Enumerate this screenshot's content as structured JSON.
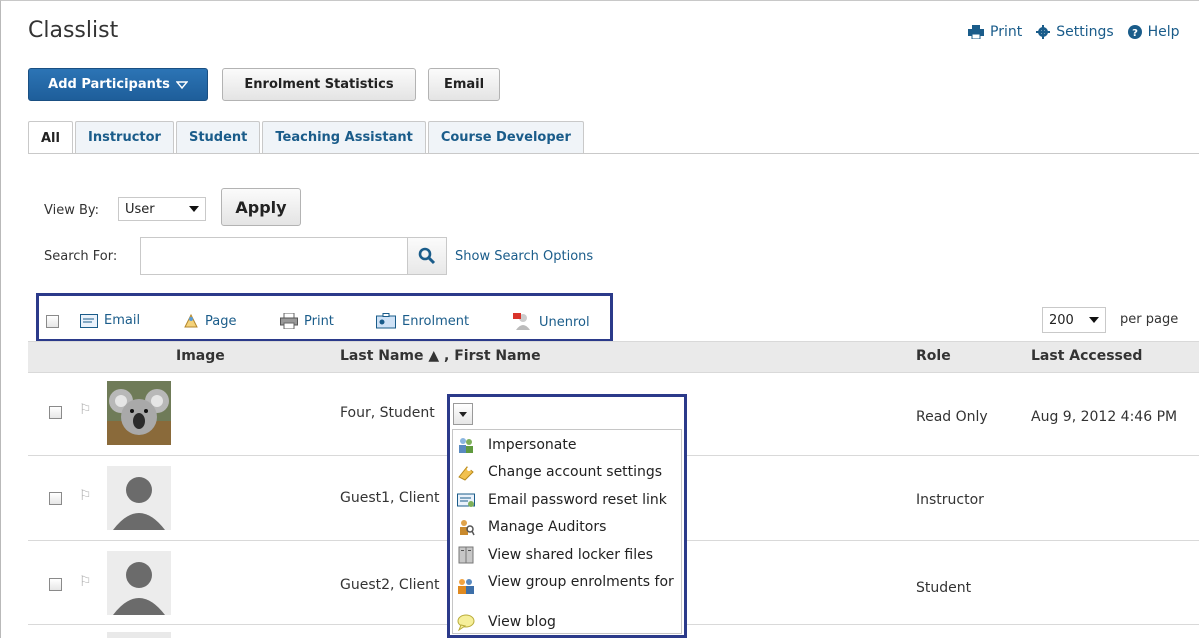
{
  "page": {
    "title": "Classlist"
  },
  "top_links": {
    "print": "Print",
    "settings": "Settings",
    "help": "Help"
  },
  "toolbar": {
    "add_participants": "Add Participants",
    "enrolment_statistics": "Enrolment Statistics",
    "email": "Email"
  },
  "tabs": [
    "All",
    "Instructor",
    "Student",
    "Teaching Assistant",
    "Course Developer"
  ],
  "view_by": {
    "label": "View By:",
    "value": "User",
    "apply": "Apply"
  },
  "search": {
    "label": "Search For:",
    "value": "",
    "show_options": "Show Search Options"
  },
  "actions": {
    "email": "Email",
    "page": "Page",
    "print": "Print",
    "enrolment": "Enrolment",
    "unenrol": "Unenrol"
  },
  "paging": {
    "per_page_value": "200",
    "per_page_label": "per page"
  },
  "table": {
    "headers": {
      "image": "Image",
      "name": "Last Name ▲ , First Name",
      "role": "Role",
      "last_accessed": "Last Accessed"
    },
    "rows": [
      {
        "name": "Four, Student",
        "role": "Read Only",
        "last_accessed": "Aug 9, 2012 4:46 PM"
      },
      {
        "name": "Guest1, Client",
        "role": "Instructor",
        "last_accessed": ""
      },
      {
        "name": "Guest2, Client",
        "role": "Student",
        "last_accessed": ""
      }
    ]
  },
  "context_menu": {
    "items": [
      "Impersonate",
      "Change account settings",
      "Email password reset link",
      "Manage Auditors",
      "View shared locker files",
      "View group enrolments for",
      "View blog"
    ],
    "icons": [
      "impersonate-icon",
      "account-settings-icon",
      "email-reset-icon",
      "auditors-icon",
      "locker-icon",
      "group-icon",
      "blog-icon"
    ]
  },
  "colors": {
    "link": "#1a5c8a",
    "primary_button": "#2c74b5",
    "highlight_border": "#2b3a8a"
  }
}
